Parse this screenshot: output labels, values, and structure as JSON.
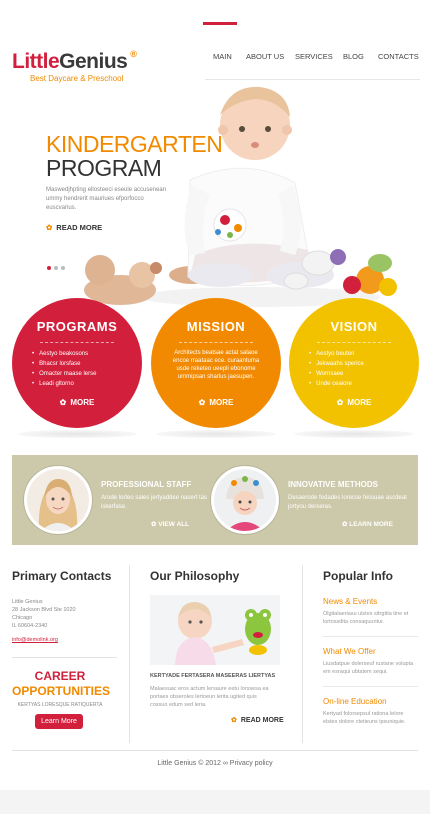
{
  "brand": {
    "name_part1": "Little",
    "name_part2": "Genius",
    "registered": "®",
    "tagline": "Best Daycare & Preschool"
  },
  "nav": {
    "items": [
      {
        "label": "MAIN"
      },
      {
        "label": "ABOUT US"
      },
      {
        "label": "SERVICES"
      },
      {
        "label": "BLOG"
      },
      {
        "label": "CONTACTS"
      }
    ]
  },
  "hero": {
    "title_line1": "KINDERGARTEN",
    "title_line2": "PROGRAM",
    "text": "Maswedjhpting ellosteeci eseule accusenean ummy hendrerit mauriues efporfocco euscvarius.",
    "read_more": "READ MORE"
  },
  "circles": [
    {
      "title": "PROGRAMS",
      "items": [
        "Aestyo beakosons",
        "Bhacsr lorsfase",
        "Omacter maase lerse",
        "Leadi gltorno"
      ],
      "more": "MORE",
      "color": "#d21f3c"
    },
    {
      "title": "MISSION",
      "text": "Architects beatsae actat salaoe encoe rraataac ece. curaantuma usde reketeo ueepli ebonome ummipsan sharlus jaesupen.",
      "more": "MORE",
      "color": "#f18a00"
    },
    {
      "title": "VISION",
      "items": [
        "Aestyo beuten",
        "Jekwaahs sperice",
        "Wornsaee",
        "Unde ceaiore"
      ],
      "more": "MORE",
      "color": "#f2c200"
    }
  ],
  "features": [
    {
      "title": "PROFESSIONAL STAFF",
      "text": "Arode lorteo sales jertyaddee nasert tas iskerfase.",
      "link": "VIEW ALL"
    },
    {
      "title": "INNOVATIVE METHODS",
      "text": "Desaerode fedades lorecse fessuae ascdeat jortyou derseras.",
      "link": "LEARN MORE"
    }
  ],
  "contacts": {
    "heading": "Primary Contacts",
    "address": [
      "Little Genius",
      "28 Jackson Blvd Ste 1020",
      "Chicago",
      "IL 60604-2340"
    ],
    "email": "info@demolink.org",
    "career_line1": "CAREER",
    "career_line2": "OPPORTUNITIES",
    "career_sub": "KERTYAS LORESQUE RATIQUERTA",
    "button": "Learn More"
  },
  "philosophy": {
    "heading": "Our Philosophy",
    "caption": "KERTYADE FERTASERA MASEERAS LIERTYAS",
    "text": "Malaesuac eros actum lersaure eetu lorssesa ea portaes obseroles lertoeun lerita ugited quis cossuo edum sed leria.",
    "read_more": "READ MORE"
  },
  "popular": {
    "heading": "Popular Info",
    "items": [
      {
        "title": "News & Events",
        "text": "Olgitalaeriasu ulstes sitrgtita tine et lortossdita consaquuntur."
      },
      {
        "title": "What We Offer",
        "text": "Liusdatpue dolerseuf rustane volupta em esraqui ubtatem sequi."
      },
      {
        "title": "On-line Education",
        "text": "Kertyad folorsepsul rationa lelore elstes dolore ctetieuns ipsuniquie."
      }
    ]
  },
  "footer": {
    "text": "Little Genius © 2012 ∞ Privacy policy"
  }
}
